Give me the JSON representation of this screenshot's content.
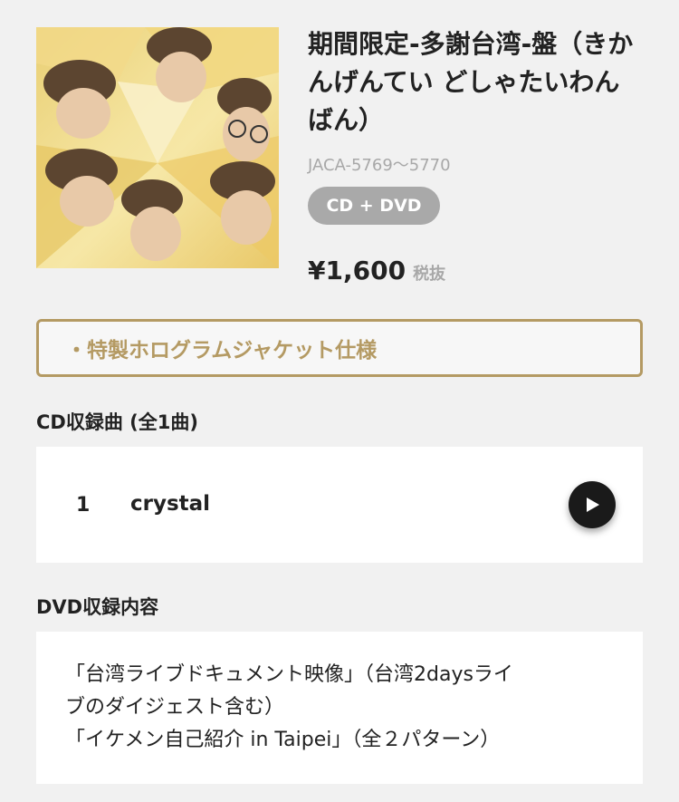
{
  "product": {
    "title": "期間限定-多謝台湾-盤（きかんげんてい どしゃたいわん ばん）",
    "catalog_number": "JACA-5769〜5770",
    "format": "CD + DVD",
    "price": "¥1,600",
    "tax_note": "税抜"
  },
  "feature": {
    "text": "・特製ホログラムジャケット仕様"
  },
  "cd_section": {
    "heading": "CD収録曲 (全1曲)",
    "tracks": [
      {
        "number": "1",
        "title": "crystal"
      }
    ]
  },
  "dvd_section": {
    "heading": "DVD収録内容",
    "lines": [
      "「台湾ライブドキュメント映像」（台湾2daysライ",
      "ブのダイジェスト含む）",
      "「イケメン自己紹介 in Taipei」（全２パターン）"
    ]
  },
  "icons": {
    "play": "play-icon"
  },
  "colors": {
    "background": "#f1f1f1",
    "accent_gold": "#b49a63",
    "pill_gray": "#a9a9a9",
    "play_button": "#1a1a1a"
  }
}
